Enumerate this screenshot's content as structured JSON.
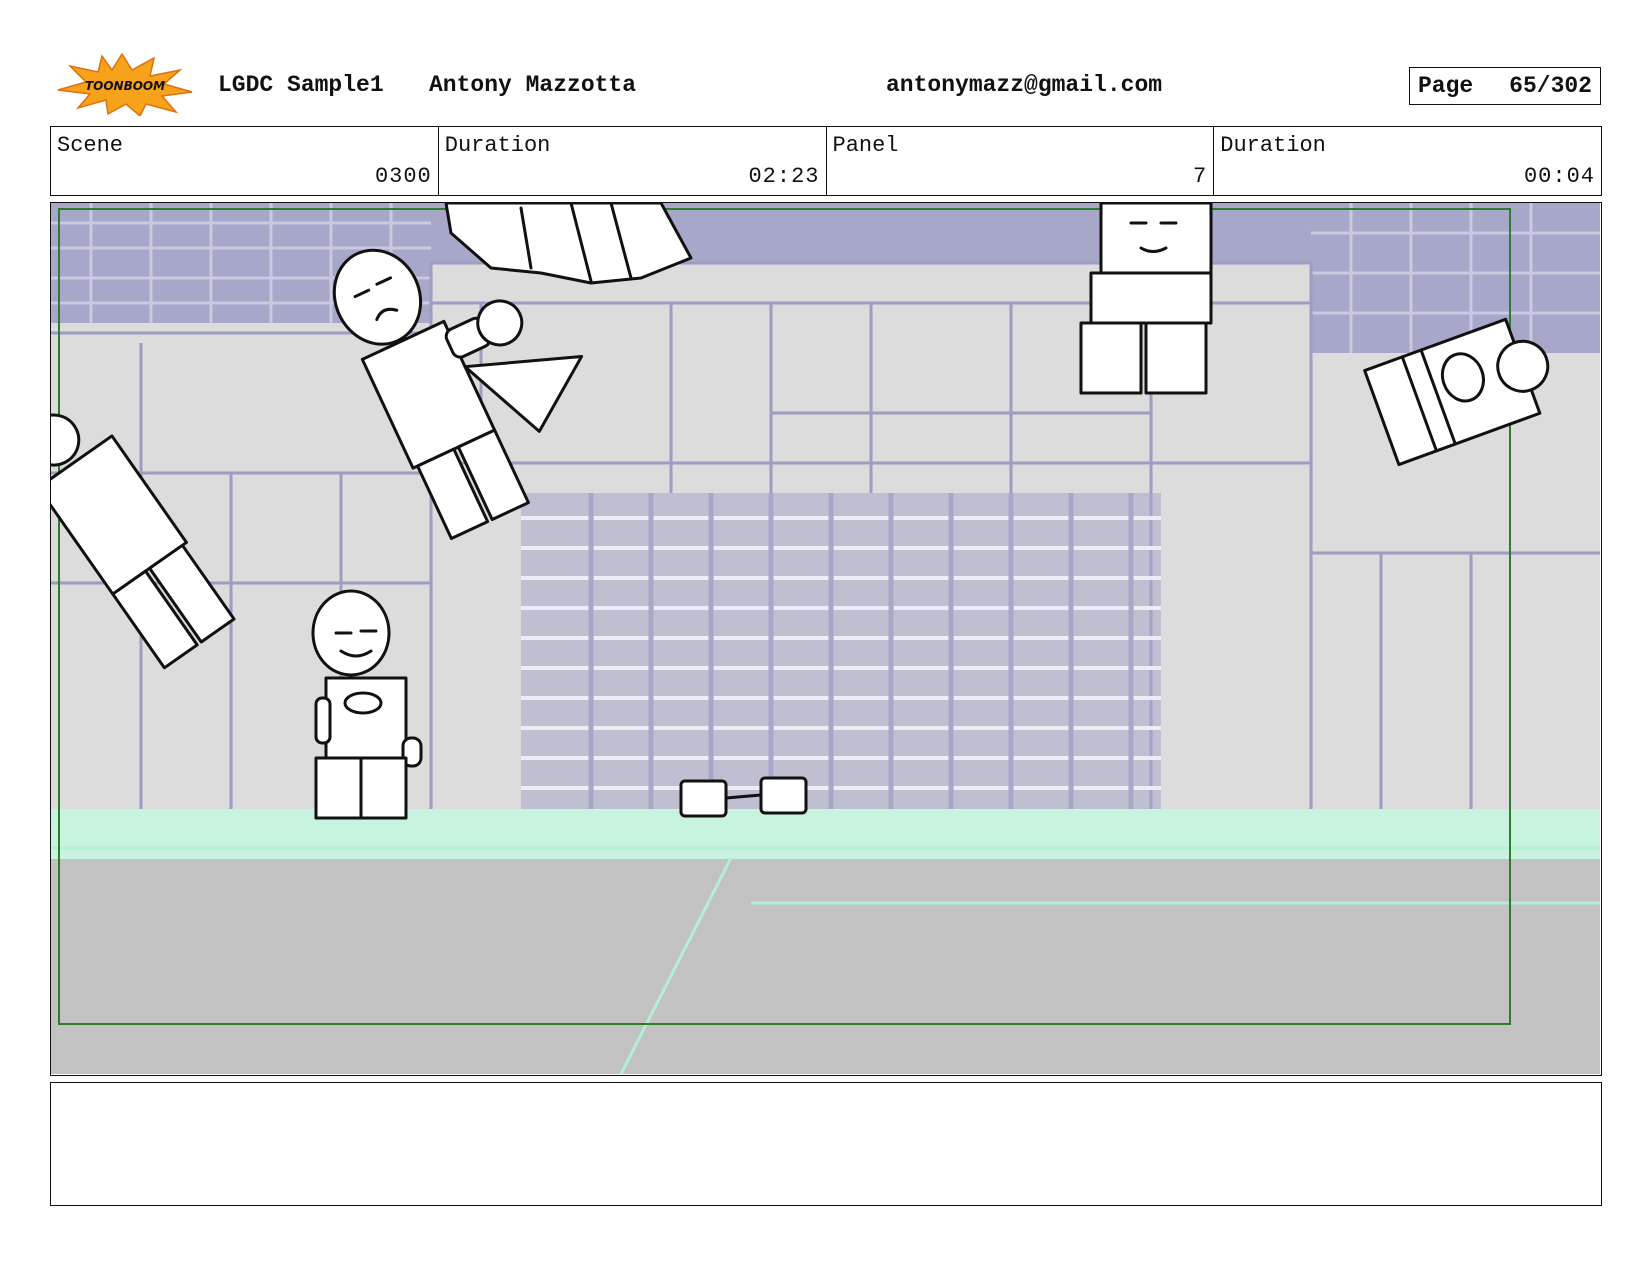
{
  "header": {
    "logo_text": "TOONBOOM",
    "project": "LGDC Sample1",
    "author": "Antony Mazzotta",
    "email": "antonymazz@gmail.com",
    "page_label": "Page",
    "page_value": "65/302"
  },
  "info": {
    "scene_label": "Scene",
    "scene_value": "0300",
    "scene_duration_label": "Duration",
    "scene_duration_value": "02:23",
    "panel_label": "Panel",
    "panel_value": "7",
    "panel_duration_label": "Duration",
    "panel_duration_value": "00:04"
  },
  "notes": {
    "text": ""
  },
  "colors": {
    "background_blue": "#a7a7c9",
    "floor_green": "#c8f3df",
    "floor_gray": "#c2c2c2",
    "frame_green": "#2e7d2e"
  }
}
